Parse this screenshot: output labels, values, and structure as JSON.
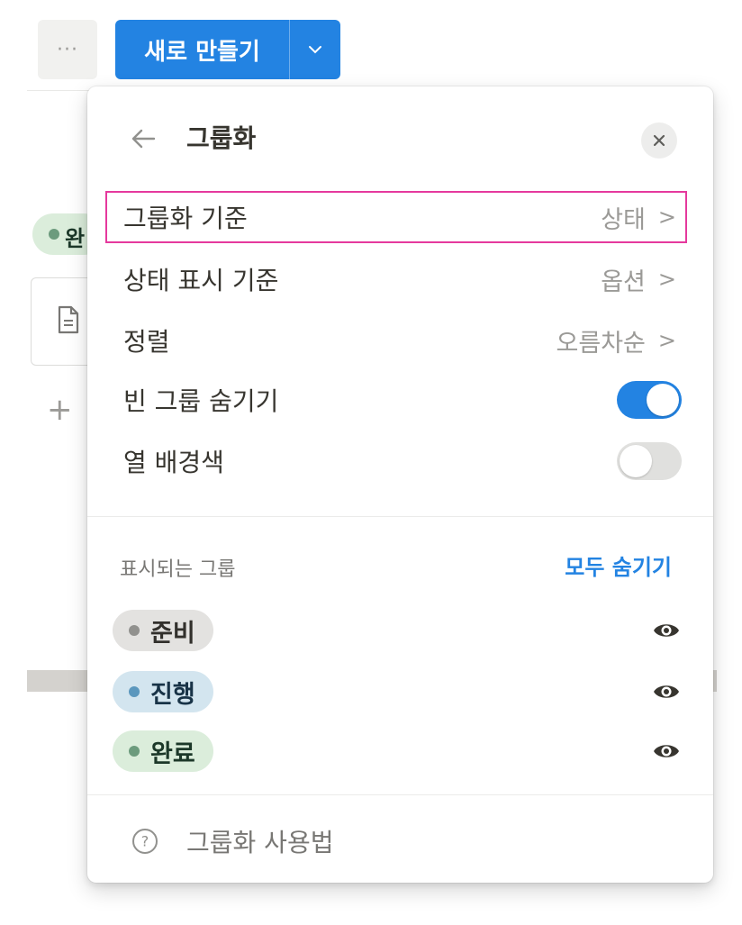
{
  "toolbar": {
    "more_label": "···",
    "new_label": "새로 만들기"
  },
  "background": {
    "badge_text": "완"
  },
  "menu": {
    "title": "그룹화",
    "rows": [
      {
        "label": "그룹화 기준",
        "value": "상태"
      },
      {
        "label": "상태 표시 기준",
        "value": "옵션"
      },
      {
        "label": "정렬",
        "value": "오름차순"
      }
    ],
    "toggles": [
      {
        "label": "빈 그룹 숨기기",
        "on": true
      },
      {
        "label": "열 배경색",
        "on": false
      }
    ],
    "chevron": ">",
    "visible_groups_title": "표시되는 그룹",
    "hide_all_label": "모두 숨기기",
    "groups": [
      {
        "name": "준비",
        "chip_bg": "#e3e2e0",
        "dot": "#91918e",
        "text": "#32302c"
      },
      {
        "name": "진행",
        "chip_bg": "#d3e5ef",
        "dot": "#5b97bd",
        "text": "#183347"
      },
      {
        "name": "완료",
        "chip_bg": "#dbeddb",
        "dot": "#6c9b7d",
        "text": "#1c3829"
      }
    ],
    "help_label": "그룹화 사용법",
    "help_icon": "?"
  },
  "colors": {
    "accent": "#2383e2",
    "highlight_outline": "#e5399d"
  }
}
